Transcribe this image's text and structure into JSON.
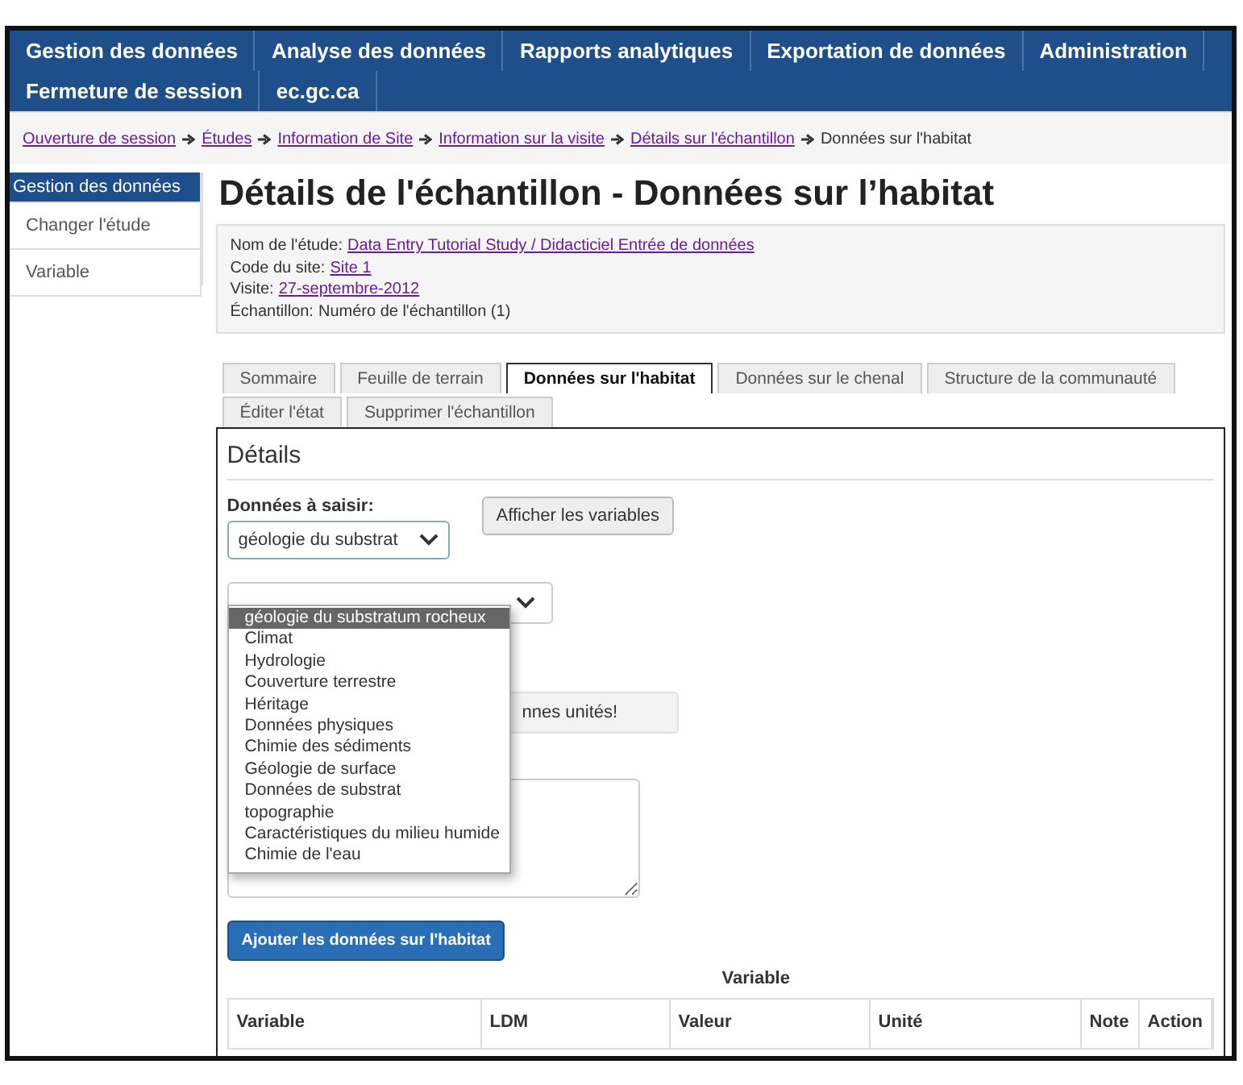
{
  "nav": [
    [
      {
        "label": "Gestion des données"
      },
      {
        "label": "Analyse des données"
      },
      {
        "label": "Rapports analytiques"
      },
      {
        "label": "Exportation de données"
      },
      {
        "label": "Administration"
      }
    ],
    [
      {
        "label": "Fermeture de session"
      },
      {
        "label": "ec.gc.ca"
      }
    ]
  ],
  "breadcrumb": [
    {
      "label": "Ouverture de session",
      "kind": "link"
    },
    {
      "label": "Études",
      "kind": "link"
    },
    {
      "label": "Information de Site",
      "kind": "link"
    },
    {
      "label": "Information sur la visite",
      "kind": "link"
    },
    {
      "label": "Détails sur l'échantillon",
      "kind": "link"
    },
    {
      "label": "Données sur l'habitat",
      "kind": "current"
    }
  ],
  "sidebar": {
    "items": [
      {
        "label": "Gestion des données",
        "selected": true
      },
      {
        "label": "Changer l'étude",
        "selected": false
      },
      {
        "label": "Variable",
        "selected": false
      }
    ]
  },
  "page_title": "Détails de l'échantillon - Données sur l’habitat",
  "info": [
    {
      "label": "Nom de l'étude:",
      "value": "Data Entry Tutorial Study / Didacticiel Entrée de données",
      "kind": "link"
    },
    {
      "label": "Code du site:",
      "value": "Site 1",
      "kind": "link"
    },
    {
      "label": "Visite:",
      "value": "27-septembre-2012",
      "kind": "link"
    },
    {
      "label": "Échantillon:",
      "value": "Numéro de l'échantillon (1)",
      "kind": "text"
    }
  ],
  "tabs": [
    [
      {
        "label": "Sommaire",
        "selected": false
      },
      {
        "label": "Feuille de terrain",
        "selected": false
      },
      {
        "label": "Données sur l'habitat",
        "selected": true
      },
      {
        "label": "Données sur le chenal",
        "selected": false
      },
      {
        "label": "Structure de la communauté",
        "selected": false
      }
    ],
    [
      {
        "label": "Éditer l'état",
        "selected": false
      },
      {
        "label": "Supprimer l'échantillon",
        "selected": false
      }
    ]
  ],
  "panel": {
    "title": "Détails",
    "data_label": "Données à saisir:",
    "data_select": {
      "value": "géologie du substrat",
      "options": [
        {
          "label": "géologie du substratum rocheux",
          "selected": true
        },
        {
          "label": "Climat",
          "selected": false
        },
        {
          "label": "Hydrologie",
          "selected": false
        },
        {
          "label": "Couverture terrestre",
          "selected": false
        },
        {
          "label": "Héritage",
          "selected": false
        },
        {
          "label": "Données physiques",
          "selected": false
        },
        {
          "label": "Chimie des sédiments",
          "selected": false
        },
        {
          "label": "Géologie de surface",
          "selected": false
        },
        {
          "label": "Données de substrat",
          "selected": false
        },
        {
          "label": "topographie",
          "selected": false
        },
        {
          "label": "Caractéristiques du milieu humide",
          "selected": false
        },
        {
          "label": "Chimie de l'eau",
          "selected": false
        }
      ]
    },
    "show_button": "Afficher les variables",
    "notice": "nnes unités!",
    "add_button": "Ajouter les données sur l'habitat",
    "table": {
      "caption": "Variable",
      "columns": [
        "Variable",
        "LDM",
        "Valeur",
        "Unité",
        "Note",
        "Action"
      ]
    }
  }
}
